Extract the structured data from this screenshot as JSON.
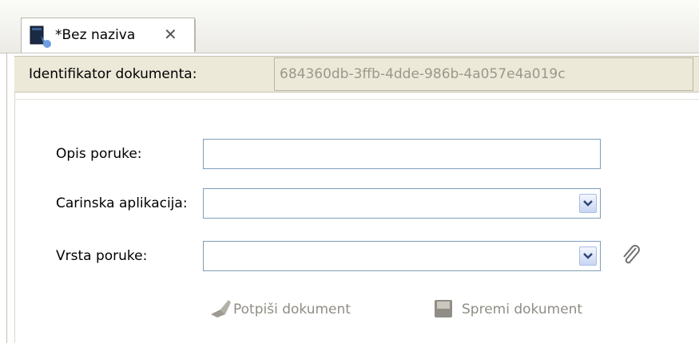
{
  "tab": {
    "title": "*Bez naziva",
    "close_glyph": "✕"
  },
  "id_bar": {
    "label": "Identifikator dokumenta:",
    "value": "684360db-3ffb-4dde-986b-4a057e4a019c"
  },
  "form": {
    "opis": {
      "label": "Opis poruke:",
      "value": ""
    },
    "carinska": {
      "label": "Carinska aplikacija:",
      "value": ""
    },
    "vrsta": {
      "label": "Vrsta poruke:",
      "value": ""
    }
  },
  "actions": {
    "sign": {
      "label": "Potpiši dokument",
      "icon": "sign-pen-icon",
      "enabled": false
    },
    "save": {
      "label": "Spremi dokument",
      "icon": "floppy-disk-icon",
      "enabled": false
    }
  },
  "colors": {
    "disabled_text": "#8f8d84",
    "field_border": "#7f9db9",
    "panel_bg": "#ece9d8"
  }
}
